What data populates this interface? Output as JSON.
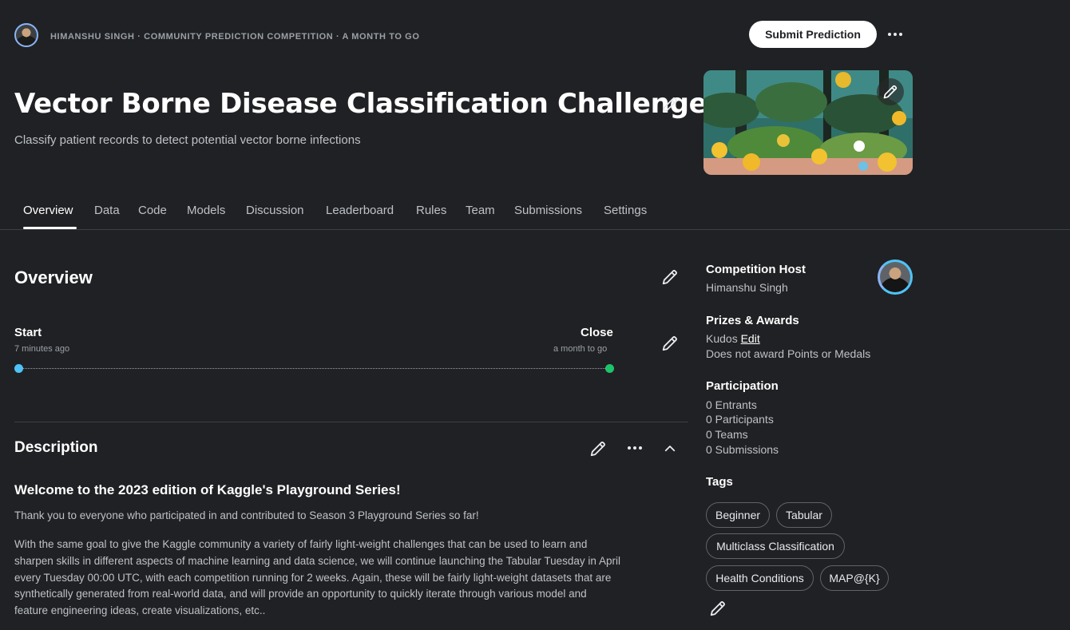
{
  "header": {
    "breadcrumb": "HIMANSHU SINGH · COMMUNITY PREDICTION COMPETITION · A MONTH TO GO",
    "submit_label": "Submit Prediction",
    "title": "Vector Borne Disease Classification Challenge",
    "subtitle": "Classify patient records to detect potential vector borne infections"
  },
  "tabs": [
    {
      "label": "Overview",
      "active": true
    },
    {
      "label": "Data"
    },
    {
      "label": "Code"
    },
    {
      "label": "Models"
    },
    {
      "label": "Discussion"
    },
    {
      "label": "Leaderboard"
    },
    {
      "label": "Rules"
    },
    {
      "label": "Team"
    },
    {
      "label": "Submissions"
    },
    {
      "label": "Settings"
    }
  ],
  "overview": {
    "heading": "Overview",
    "start_label": "Start",
    "start_time": "7 minutes ago",
    "close_label": "Close",
    "close_time": "a month to go"
  },
  "description": {
    "heading": "Description",
    "welcome": "Welcome to the 2023 edition of Kaggle's Playground Series!",
    "para1": "Thank you to everyone who participated in and contributed to Season 3 Playground Series so far!",
    "para2": "With the same goal to give the Kaggle community a variety of fairly light-weight challenges that can be used to learn and sharpen skills in different aspects of machine learning and data science, we will continue launching the Tabular Tuesday in April every Tuesday 00:00 UTC, with each competition running for 2 weeks. Again, these will be fairly light-weight datasets that are synthetically generated from real-world data, and will provide an opportunity to quickly iterate through various model and feature engineering ideas, create visualizations, etc.."
  },
  "sidebar": {
    "host_heading": "Competition Host",
    "host_name": "Himanshu Singh",
    "prizes_heading": "Prizes & Awards",
    "kudos": "Kudos",
    "edit_link": "Edit",
    "no_points": "Does not award Points or Medals",
    "participation_heading": "Participation",
    "entrants": "0 Entrants",
    "participants": "0 Participants",
    "teams": "0 Teams",
    "submissions": "0 Submissions",
    "tags_heading": "Tags",
    "tags": [
      "Beginner",
      "Tabular",
      "Multiclass Classification",
      "Health Conditions",
      "MAP@{K}"
    ]
  },
  "colors": {
    "background": "#202124",
    "accent_start": "#4fc3f7",
    "accent_end": "#1ec46b"
  }
}
